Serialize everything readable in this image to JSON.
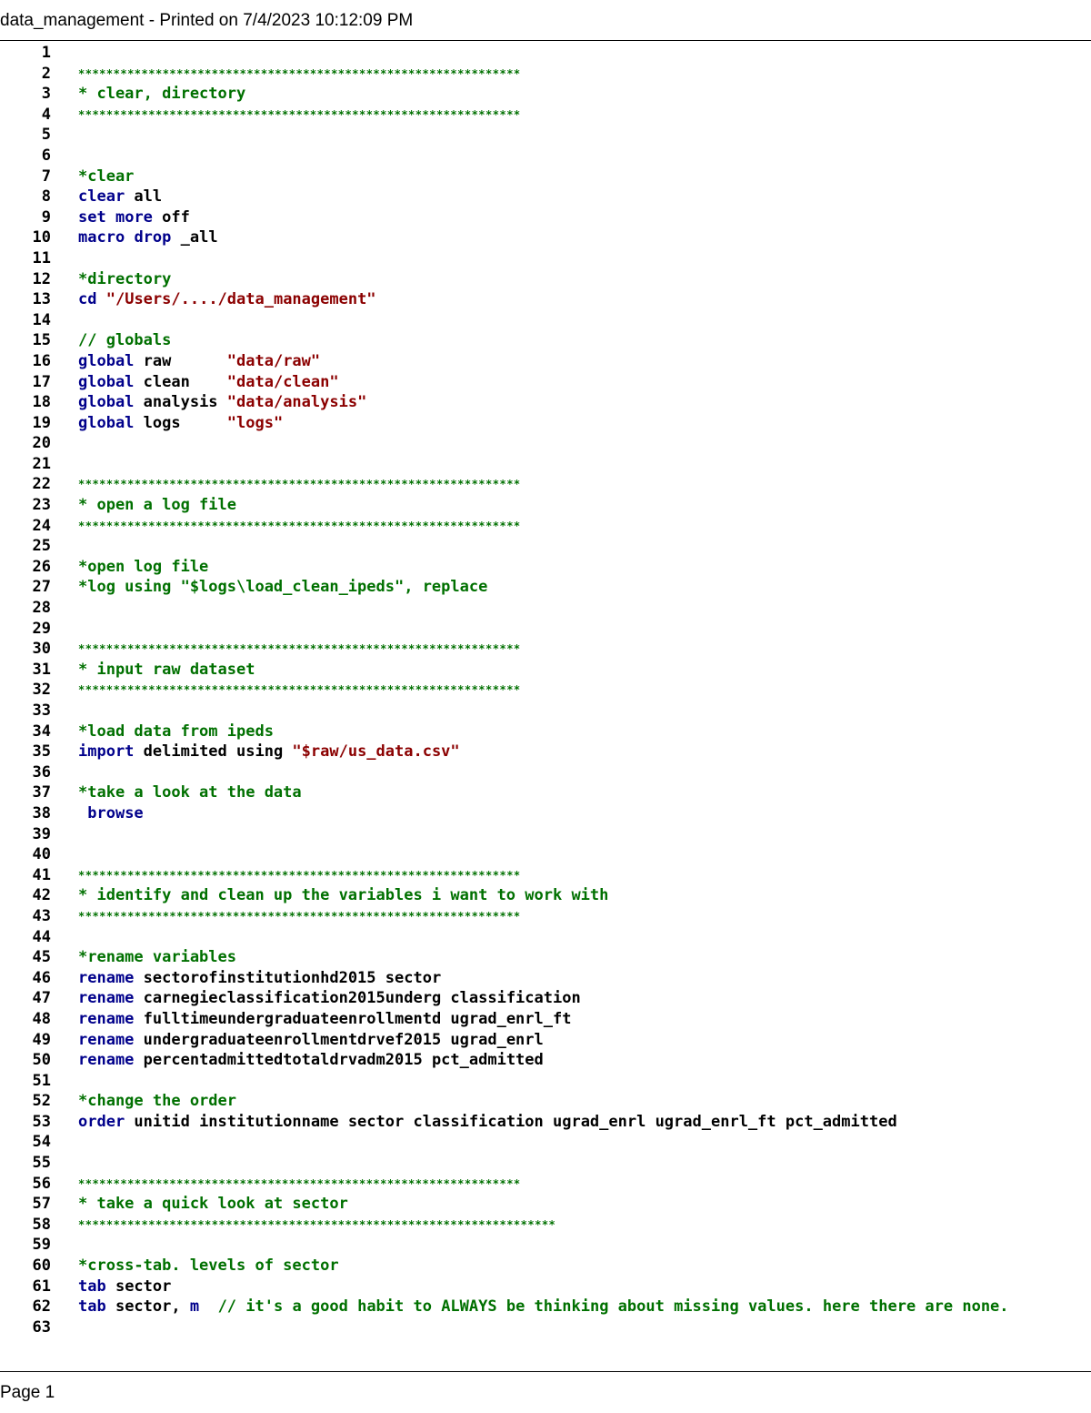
{
  "header": {
    "title": "data_management - Printed on 7/4/2023 10:12:09 PM"
  },
  "footer": {
    "page_label": "Page 1"
  },
  "colors": {
    "keyword": "#00008b",
    "string": "#8b0000",
    "comment": "#007000",
    "plain": "#000000"
  },
  "code": {
    "lines": [
      {
        "n": "1",
        "segs": []
      },
      {
        "n": "2",
        "stars": true,
        "segs": [
          {
            "t": "***************************************************************",
            "c": "cmt"
          }
        ]
      },
      {
        "n": "3",
        "segs": [
          {
            "t": "* clear, directory",
            "c": "cmt"
          }
        ]
      },
      {
        "n": "4",
        "stars": true,
        "segs": [
          {
            "t": "***************************************************************",
            "c": "cmt"
          }
        ]
      },
      {
        "n": "5",
        "segs": []
      },
      {
        "n": "6",
        "segs": []
      },
      {
        "n": "7",
        "segs": [
          {
            "t": "*clear",
            "c": "cmt"
          }
        ]
      },
      {
        "n": "8",
        "segs": [
          {
            "t": "clear",
            "c": "kw"
          },
          {
            "t": " all",
            "c": "pl"
          }
        ]
      },
      {
        "n": "9",
        "segs": [
          {
            "t": "set",
            "c": "kw"
          },
          {
            "t": " ",
            "c": "pl"
          },
          {
            "t": "more",
            "c": "kw"
          },
          {
            "t": " off",
            "c": "pl"
          }
        ]
      },
      {
        "n": "10",
        "segs": [
          {
            "t": "macro",
            "c": "kw"
          },
          {
            "t": " ",
            "c": "pl"
          },
          {
            "t": "drop",
            "c": "kw"
          },
          {
            "t": " _all",
            "c": "pl"
          }
        ]
      },
      {
        "n": "11",
        "segs": []
      },
      {
        "n": "12",
        "segs": [
          {
            "t": "*directory",
            "c": "cmt"
          }
        ]
      },
      {
        "n": "13",
        "segs": [
          {
            "t": "cd",
            "c": "kw"
          },
          {
            "t": " ",
            "c": "pl"
          },
          {
            "t": "\"/Users/..../data_management\"",
            "c": "str"
          }
        ]
      },
      {
        "n": "14",
        "segs": []
      },
      {
        "n": "15",
        "segs": [
          {
            "t": "// globals",
            "c": "cmt"
          }
        ]
      },
      {
        "n": "16",
        "segs": [
          {
            "t": "global",
            "c": "kw"
          },
          {
            "t": " raw      ",
            "c": "pl"
          },
          {
            "t": "\"data/raw\"",
            "c": "str"
          }
        ]
      },
      {
        "n": "17",
        "segs": [
          {
            "t": "global",
            "c": "kw"
          },
          {
            "t": " clean    ",
            "c": "pl"
          },
          {
            "t": "\"data/clean\"",
            "c": "str"
          }
        ]
      },
      {
        "n": "18",
        "segs": [
          {
            "t": "global",
            "c": "kw"
          },
          {
            "t": " analysis ",
            "c": "pl"
          },
          {
            "t": "\"data/analysis\"",
            "c": "str"
          }
        ]
      },
      {
        "n": "19",
        "segs": [
          {
            "t": "global",
            "c": "kw"
          },
          {
            "t": " logs     ",
            "c": "pl"
          },
          {
            "t": "\"logs\"",
            "c": "str"
          }
        ]
      },
      {
        "n": "20",
        "segs": []
      },
      {
        "n": "21",
        "segs": []
      },
      {
        "n": "22",
        "stars": true,
        "segs": [
          {
            "t": "***************************************************************",
            "c": "cmt"
          }
        ]
      },
      {
        "n": "23",
        "segs": [
          {
            "t": "* open a log file",
            "c": "cmt"
          }
        ]
      },
      {
        "n": "24",
        "stars": true,
        "segs": [
          {
            "t": "***************************************************************",
            "c": "cmt"
          }
        ]
      },
      {
        "n": "25",
        "segs": []
      },
      {
        "n": "26",
        "segs": [
          {
            "t": "*open log file",
            "c": "cmt"
          }
        ]
      },
      {
        "n": "27",
        "segs": [
          {
            "t": "*log using \"$logs\\load_clean_ipeds\", replace",
            "c": "cmt"
          }
        ]
      },
      {
        "n": "28",
        "segs": []
      },
      {
        "n": "29",
        "segs": []
      },
      {
        "n": "30",
        "stars": true,
        "segs": [
          {
            "t": "***************************************************************",
            "c": "cmt"
          }
        ]
      },
      {
        "n": "31",
        "segs": [
          {
            "t": "* input raw dataset",
            "c": "cmt"
          }
        ]
      },
      {
        "n": "32",
        "stars": true,
        "segs": [
          {
            "t": "***************************************************************",
            "c": "cmt"
          }
        ]
      },
      {
        "n": "33",
        "segs": []
      },
      {
        "n": "34",
        "segs": [
          {
            "t": "*load data from ipeds",
            "c": "cmt"
          }
        ]
      },
      {
        "n": "35",
        "segs": [
          {
            "t": "import",
            "c": "kw"
          },
          {
            "t": " delimited using ",
            "c": "pl"
          },
          {
            "t": "\"$raw/us_data.csv\"",
            "c": "str"
          }
        ]
      },
      {
        "n": "36",
        "segs": []
      },
      {
        "n": "37",
        "segs": [
          {
            "t": "*take a look at the data",
            "c": "cmt"
          }
        ]
      },
      {
        "n": "38",
        "segs": [
          {
            "t": " ",
            "c": "pl"
          },
          {
            "t": "browse",
            "c": "kw"
          }
        ]
      },
      {
        "n": "39",
        "segs": []
      },
      {
        "n": "40",
        "segs": []
      },
      {
        "n": "41",
        "stars": true,
        "segs": [
          {
            "t": "***************************************************************",
            "c": "cmt"
          }
        ]
      },
      {
        "n": "42",
        "segs": [
          {
            "t": "* identify and clean up the variables i want to work with",
            "c": "cmt"
          }
        ]
      },
      {
        "n": "43",
        "stars": true,
        "segs": [
          {
            "t": "***************************************************************",
            "c": "cmt"
          }
        ]
      },
      {
        "n": "44",
        "segs": []
      },
      {
        "n": "45",
        "segs": [
          {
            "t": "*rename variables",
            "c": "cmt"
          }
        ]
      },
      {
        "n": "46",
        "segs": [
          {
            "t": "rename",
            "c": "kw"
          },
          {
            "t": " sectorofinstitutionhd2015 sector",
            "c": "pl"
          }
        ]
      },
      {
        "n": "47",
        "segs": [
          {
            "t": "rename",
            "c": "kw"
          },
          {
            "t": " carnegieclassification2015underg classification",
            "c": "pl"
          }
        ]
      },
      {
        "n": "48",
        "segs": [
          {
            "t": "rename",
            "c": "kw"
          },
          {
            "t": " fulltimeundergraduateenrollmentd ugrad_enrl_ft",
            "c": "pl"
          }
        ]
      },
      {
        "n": "49",
        "segs": [
          {
            "t": "rename",
            "c": "kw"
          },
          {
            "t": " undergraduateenrollmentdrvef2015 ugrad_enrl",
            "c": "pl"
          }
        ]
      },
      {
        "n": "50",
        "segs": [
          {
            "t": "rename",
            "c": "kw"
          },
          {
            "t": " percentadmittedtotaldrvadm2015 pct_admitted",
            "c": "pl"
          }
        ]
      },
      {
        "n": "51",
        "segs": []
      },
      {
        "n": "52",
        "segs": [
          {
            "t": "*change the order",
            "c": "cmt"
          }
        ]
      },
      {
        "n": "53",
        "segs": [
          {
            "t": "order",
            "c": "kw"
          },
          {
            "t": " unitid institutionname sector classification ugrad_enrl ugrad_enrl_ft pct_admitted",
            "c": "pl"
          }
        ]
      },
      {
        "n": "54",
        "segs": []
      },
      {
        "n": "55",
        "segs": []
      },
      {
        "n": "56",
        "stars": true,
        "segs": [
          {
            "t": "***************************************************************",
            "c": "cmt"
          }
        ]
      },
      {
        "n": "57",
        "segs": [
          {
            "t": "* take a quick look at sector",
            "c": "cmt"
          }
        ]
      },
      {
        "n": "58",
        "stars": true,
        "segs": [
          {
            "t": "********************************************************************",
            "c": "cmt"
          }
        ]
      },
      {
        "n": "59",
        "segs": []
      },
      {
        "n": "60",
        "segs": [
          {
            "t": "*cross-tab. levels of sector",
            "c": "cmt"
          }
        ]
      },
      {
        "n": "61",
        "segs": [
          {
            "t": "tab",
            "c": "kw"
          },
          {
            "t": " sector",
            "c": "pl"
          }
        ]
      },
      {
        "n": "62",
        "segs": [
          {
            "t": "tab",
            "c": "kw"
          },
          {
            "t": " sector, ",
            "c": "pl"
          },
          {
            "t": "m",
            "c": "kw"
          },
          {
            "t": "  // it's a good habit to ALWAYS be thinking about missing values. here there are none.",
            "c": "cmt"
          }
        ]
      },
      {
        "n": "63",
        "segs": []
      }
    ]
  }
}
